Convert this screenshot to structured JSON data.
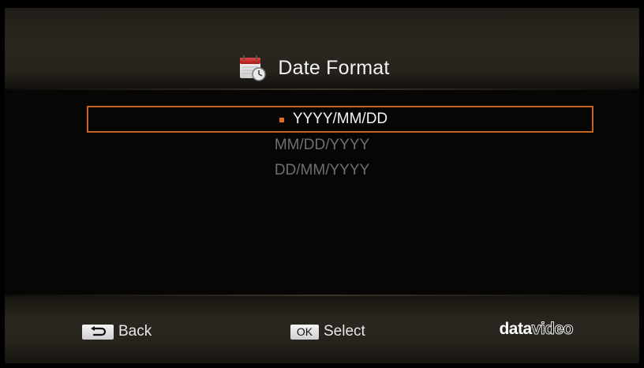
{
  "menu": {
    "title": "Date Format",
    "icon": "calendar-clock-icon"
  },
  "options": [
    {
      "label": "YYYY/MM/DD",
      "selected": true
    },
    {
      "label": "MM/DD/YYYY",
      "selected": false
    },
    {
      "label": "DD/MM/YYYY",
      "selected": false
    }
  ],
  "footer": {
    "back_label": "Back",
    "back_icon": "return-arrow-icon",
    "ok_key_label": "OK",
    "select_label": "Select",
    "brand_part1": "data",
    "brand_part2": "video"
  },
  "colors": {
    "highlight": "#c4641f",
    "selected_text": "#f4f4f4",
    "unselected_text": "#6f6f6f"
  }
}
